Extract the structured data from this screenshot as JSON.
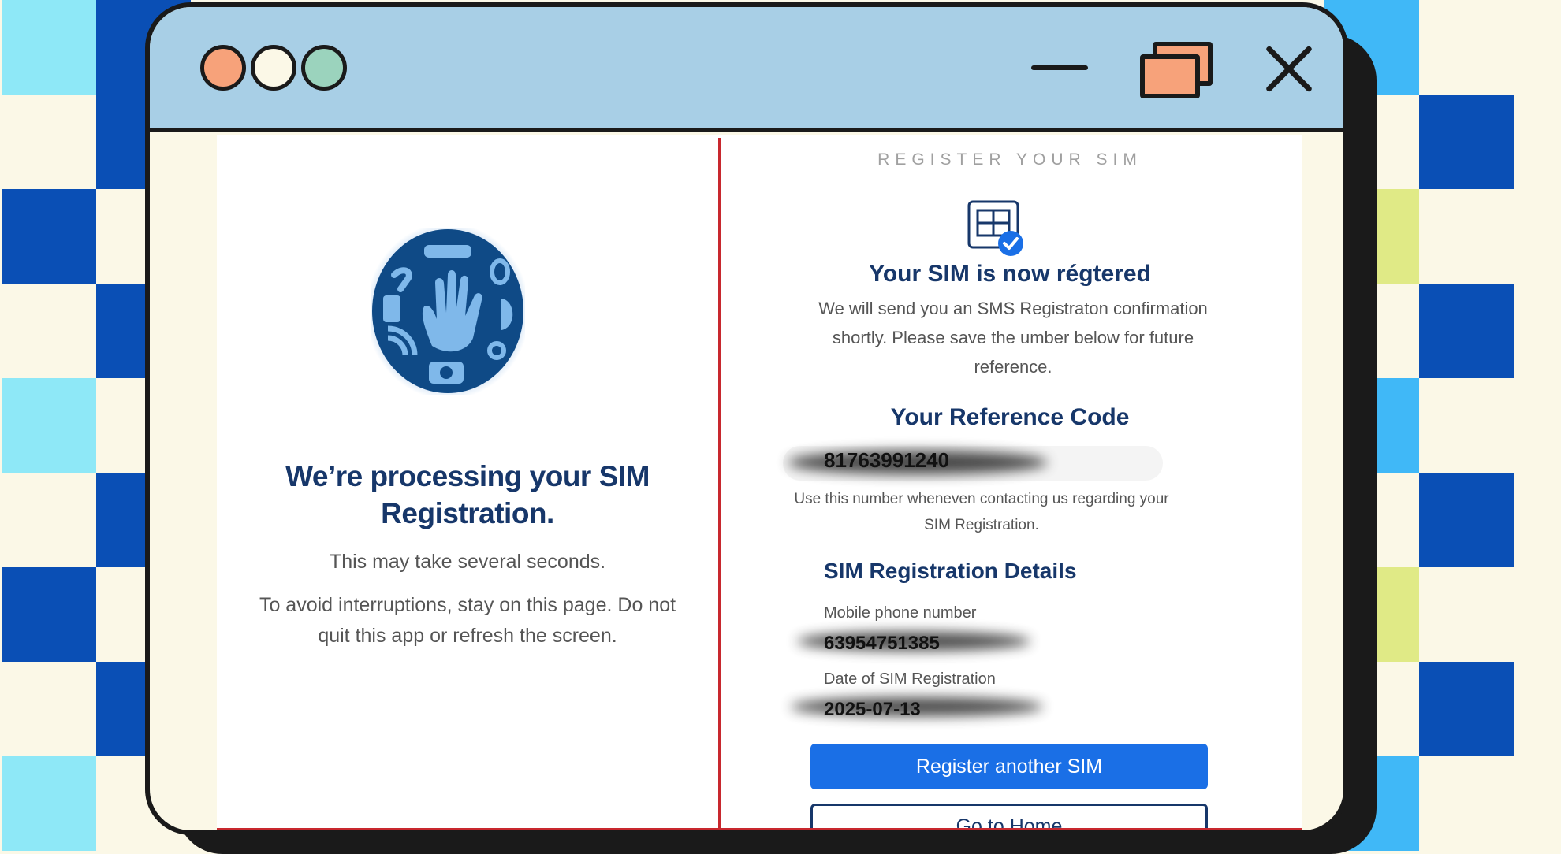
{
  "colors": {
    "title_bar": "#a8cfe6",
    "accent_blue": "#1a6fe6",
    "navy": "#17376a",
    "divider_red": "#c8282e"
  },
  "window": {
    "traffic_lights": [
      "orange-dot",
      "cream-dot",
      "green-dot"
    ],
    "controls": [
      "minimize-icon",
      "restore-icon",
      "close-icon"
    ]
  },
  "left": {
    "logo_icon": "hand-globe-icon",
    "title_line1": "We’re processing your SIM",
    "title_line2": "Registration.",
    "subtitle": "This may take several seconds.",
    "note": "To avoid interruptions, stay on this page. Do not quit this app or refresh the screen."
  },
  "right": {
    "heading": "REGISTER YOUR SIM",
    "success_icon": "sim-check-icon",
    "success_title": "Your SIM is now régtered",
    "message": "We will send you an SMS Registraton confirmation shortly. Please save the umber below for future reference.",
    "reference_label": "Your Reference Code",
    "reference_code": "81763991240",
    "reference_hint": "Use this number wheneven contacting us regarding your SIM Registration.",
    "details_heading": "SIM Registration Details",
    "mobile_label": "Mobile phone number",
    "mobile_value": "63954751385",
    "date_label": "Date of SIM Registration",
    "date_value": "2025-07-13",
    "primary_button": "Register another SIM",
    "secondary_button": "Go to Home"
  }
}
